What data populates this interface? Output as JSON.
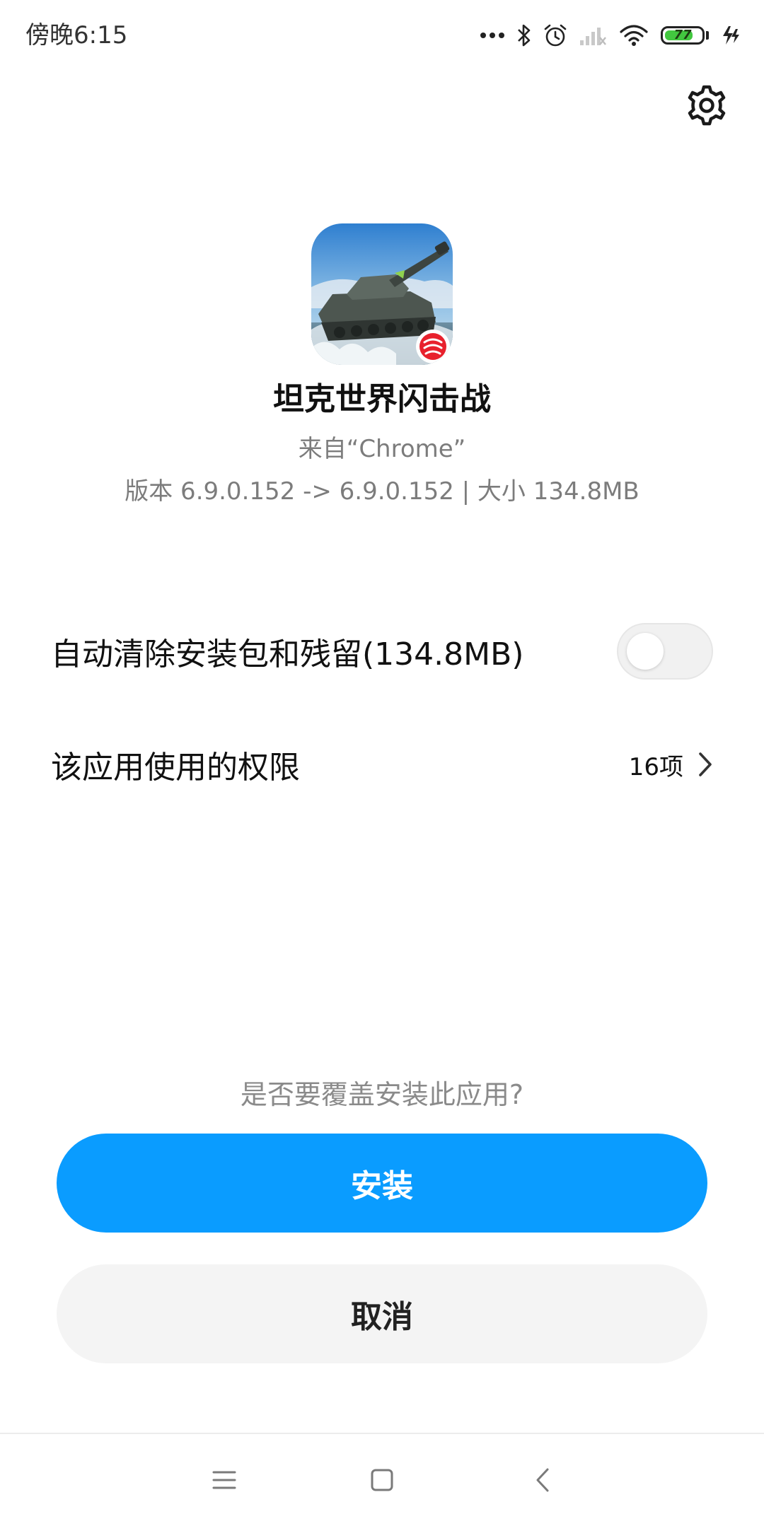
{
  "status_bar": {
    "time": "傍晚6:15",
    "battery_level": "77",
    "icons": [
      "more-dots-icon",
      "bluetooth-icon",
      "alarm-icon",
      "signal-icon",
      "wifi-icon",
      "battery-icon",
      "charging-icon"
    ]
  },
  "header": {
    "settings_icon": "gear-icon"
  },
  "app": {
    "name": "坦克世界闪击战",
    "source": "来自“Chrome”",
    "version_info": "版本 6.9.0.152 -> 6.9.0.152 | 大小 134.8MB"
  },
  "options": {
    "auto_clean_label": "自动清除安装包和残留(134.8MB)",
    "auto_clean_enabled": false,
    "permissions_label": "该应用使用的权限",
    "permissions_count": "16项"
  },
  "prompt": "是否要覆盖安装此应用?",
  "buttons": {
    "install": "安装",
    "cancel": "取消"
  },
  "nav_bar": {
    "icons": [
      "menu-icon",
      "home-icon",
      "back-icon"
    ]
  },
  "colors": {
    "primary": "#0a9cff",
    "battery": "#42c73f",
    "secondary_text": "#7c7c7c"
  }
}
